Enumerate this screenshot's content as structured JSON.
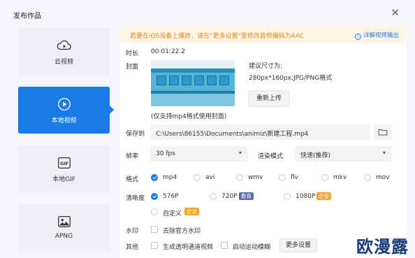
{
  "window": {
    "title": "发布作品",
    "close": "✕"
  },
  "nav": {
    "items": [
      {
        "label": "云视频",
        "icon": "cloud-play-icon",
        "active": false
      },
      {
        "label": "本地视频",
        "icon": "play-icon",
        "active": true
      },
      {
        "label": "本地GIF",
        "icon": "gif-icon",
        "active": false
      },
      {
        "label": "APNG",
        "icon": "image-icon",
        "active": false
      }
    ]
  },
  "notice": {
    "text": "若要在iOS设备上播放，请在\"更多设置\"里修改音频编码为AAC",
    "link": "详解视频输出",
    "color": "#e6871b"
  },
  "form": {
    "duration_label": "时长",
    "duration_value": "00:01:22.2",
    "cover_label": "封面",
    "cover_hint_title": "建议尺寸为:",
    "cover_hint_size": "280px*160px;JPG/PNG格式",
    "reupload": "重新上传",
    "cover_note": "(仅支持mp4格式使用封面)",
    "save_label": "保存到",
    "save_path": "C:\\Users\\86155\\Documents\\animiz\\新建工程.mp4",
    "fps_label": "帧率",
    "fps_value": "30 fps",
    "render_label": "渲染模式",
    "render_value": "快速(推荐)",
    "format_label": "格式",
    "formats": [
      {
        "label": "mp4",
        "selected": true
      },
      {
        "label": "avi",
        "selected": false
      },
      {
        "label": "wmv",
        "selected": false
      },
      {
        "label": "flv",
        "selected": false
      },
      {
        "label": "mkv",
        "selected": false
      },
      {
        "label": "mov",
        "selected": false
      }
    ],
    "resolution_label": "清晰度",
    "resolutions": [
      {
        "label": "576P",
        "selected": true,
        "tag": ""
      },
      {
        "label": "720P",
        "selected": false,
        "tag": "教育"
      },
      {
        "label": "1080P",
        "selected": false,
        "tag": "企业"
      },
      {
        "label": "自定义",
        "selected": false,
        "tag": "企业"
      }
    ],
    "watermark_label": "水印",
    "remove_watermark": "去除官方水印",
    "other_label": "其他",
    "alpha_video": "生成透明通道视频",
    "motion_blur": "启动运动模糊",
    "more_settings": "更多设置"
  },
  "brand_watermark": "欧漫露",
  "colors": {
    "accent": "#1a7ae8",
    "warning": "#e6871b",
    "edu_tag": "#5a6bb0",
    "ent_tag": "#f2a62e"
  }
}
